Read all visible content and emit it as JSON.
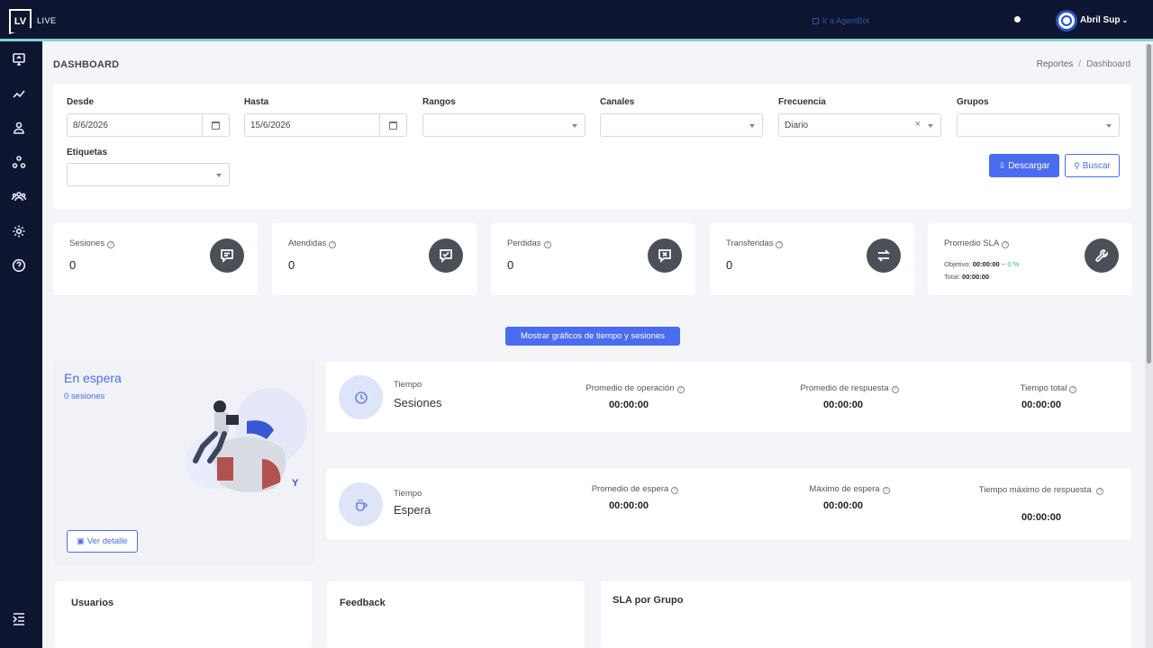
{
  "app": {
    "logo": "LV",
    "name": "LIVE"
  },
  "header": {
    "agent_link": "Ir a AgentBot",
    "user_name": "Abril Sup"
  },
  "sidebar": {
    "items": [
      "monitor-icon",
      "trend-icon",
      "user-icon",
      "network-icon",
      "team-icon",
      "gear-icon",
      "help-icon"
    ],
    "bottom": "collapse-icon"
  },
  "page": {
    "title": "DASHBOARD",
    "breadcrumb": [
      "Reportes",
      "Dashboard"
    ]
  },
  "filters": {
    "desde": {
      "label": "Desde",
      "value": "8/6/2026"
    },
    "hasta": {
      "label": "Hasta",
      "value": "15/6/2026"
    },
    "rangos": {
      "label": "Rangos",
      "value": ""
    },
    "canales": {
      "label": "Canales",
      "value": ""
    },
    "frecuencia": {
      "label": "Frecuencia",
      "value": "Diario"
    },
    "grupos": {
      "label": "Grupos",
      "value": ""
    },
    "etiquetas": {
      "label": "Etiquetas",
      "value": ""
    },
    "download_label": "Descargar",
    "search_label": "Buscar"
  },
  "stats": [
    {
      "label": "Sesiones",
      "value": "0",
      "icon": "chat-icon"
    },
    {
      "label": "Atendidas",
      "value": "0",
      "icon": "chat-check-icon"
    },
    {
      "label": "Perdidas",
      "value": "0",
      "icon": "chat-x-icon"
    },
    {
      "label": "Transferidas",
      "value": "0",
      "icon": "transfer-icon"
    }
  ],
  "sla": {
    "label": "Promedio SLA",
    "objetivo_label": "Objetivo:",
    "objetivo_value": "00:00:00",
    "sep": "~",
    "pct": "0 %",
    "total_label": "Total:",
    "total_value": "00:00:00",
    "icon": "wrench-icon"
  },
  "toggle_label": "Mostrar gráficos de tiempo y sesiones",
  "waiting": {
    "title": "En espera",
    "subtitle": "0 sesiones",
    "detail_label": "Ver detalle"
  },
  "sessions_time": {
    "small": "Tiempo",
    "big": "Sesiones",
    "metrics": [
      {
        "label": "Promedio de operación",
        "value": "00:00:00"
      },
      {
        "label": "Promedio de respuesta",
        "value": "00:00:00"
      },
      {
        "label": "Tiempo total",
        "value": "00:00:00"
      }
    ]
  },
  "wait_time": {
    "small": "Tiempo",
    "big": "Espera",
    "metrics": [
      {
        "label": "Promedio de espera",
        "value": "00:00:00"
      },
      {
        "label": "Máximo de espera",
        "value": "00:00:00"
      },
      {
        "label": "Tiempo máximo de respuesta",
        "value": "00:00:00"
      }
    ]
  },
  "bottom": {
    "usuarios": "Usuarios",
    "feedback": "Feedback",
    "sla_grupo": "SLA por Grupo"
  },
  "colors": {
    "primary": "#4a6cf0",
    "topbar": "#0e1530",
    "accent_line": "#7fd3cf",
    "sla_pct": "#2fb99d"
  }
}
